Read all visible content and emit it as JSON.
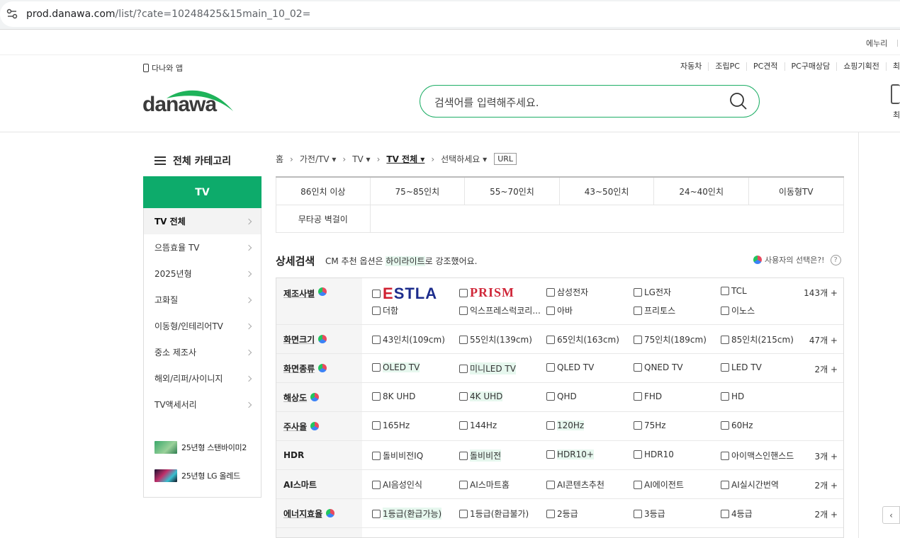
{
  "browser": {
    "url_host": "prod.danawa.com",
    "url_path": "/list/?cate=10248425&15main_10_02="
  },
  "util": {
    "right_link": "에누리"
  },
  "header": {
    "app_link": "다나와 앱",
    "top_links": [
      "자동차",
      "조립PC",
      "PC견적",
      "PC구매상담",
      "쇼핑기획전",
      "최"
    ],
    "logo_text": "danawa",
    "search_placeholder": "검색어를 입력해주세요.",
    "side_label": "최"
  },
  "sidebar": {
    "title": "전체 카테고리",
    "category": "TV",
    "items": [
      "TV 전체",
      "으뜸효율 TV",
      "2025년형",
      "고화질",
      "이동형/인테리어TV",
      "중소 제조사",
      "해외/리퍼/사이니지",
      "TV액세서리"
    ],
    "promos": [
      "25년형 스탠바이미2",
      "25년형 LG 올레드"
    ]
  },
  "breadcrumb": [
    "홈",
    "가전/TV",
    "TV",
    "TV 전체",
    "선택하세요",
    "URL"
  ],
  "size_filters": {
    "row1": [
      "86인치 이상",
      "75~85인치",
      "55~70인치",
      "43~50인치",
      "24~40인치",
      "이동형TV"
    ],
    "row2": [
      "무타공 벽걸이"
    ]
  },
  "detail": {
    "title": "상세검색",
    "note_prefix": "CM 추천 옵션은 ",
    "note_highlight": "하이라이트",
    "note_suffix": "로 강조했어요.",
    "user_choice": "사용자의 선택은?!",
    "help": "?"
  },
  "spec_rows": [
    {
      "label": "제조사별",
      "count": "143개 +",
      "options": [
        "ESTLA",
        "PRISM",
        "삼성전자",
        "LG전자",
        "TCL",
        "더함",
        "익스프레스럭코리...",
        "아바",
        "프리토스",
        "이노스"
      ]
    },
    {
      "label": "화면크기",
      "count": "47개 +",
      "options": [
        "43인치(109cm)",
        "55인치(139cm)",
        "65인치(163cm)",
        "75인치(189cm)",
        "85인치(215cm)"
      ]
    },
    {
      "label": "화면종류",
      "count": "2개 +",
      "options": [
        "OLED TV",
        "미니LED TV",
        "QLED TV",
        "QNED TV",
        "LED TV"
      ]
    },
    {
      "label": "해상도",
      "count": "",
      "options": [
        "8K UHD",
        "4K UHD",
        "QHD",
        "FHD",
        "HD"
      ]
    },
    {
      "label": "주사율",
      "count": "",
      "options": [
        "165Hz",
        "144Hz",
        "120Hz",
        "75Hz",
        "60Hz"
      ]
    },
    {
      "label": "HDR",
      "count": "3개 +",
      "options": [
        "돌비비전IQ",
        "돌비비전",
        "HDR10+",
        "HDR10",
        "아이맥스인핸스드"
      ]
    },
    {
      "label": "AI스마트",
      "count": "2개 +",
      "options": [
        "AI음성인식",
        "AI스마트홈",
        "AI콘텐츠추천",
        "AI에이전트",
        "AI실시간번역"
      ]
    },
    {
      "label": "에너지효율",
      "count": "2개 +",
      "options": [
        "1등급(환급가능)",
        "1등급(환급불가)",
        "2등급",
        "3등급",
        "4등급"
      ]
    },
    {
      "label": "",
      "count": "",
      "options": [
        "",
        "",
        "",
        "",
        ""
      ]
    }
  ],
  "colors": {
    "accent": "#0dab6b",
    "search_border": "#1eae66",
    "highlight": "#e6f7ee"
  }
}
